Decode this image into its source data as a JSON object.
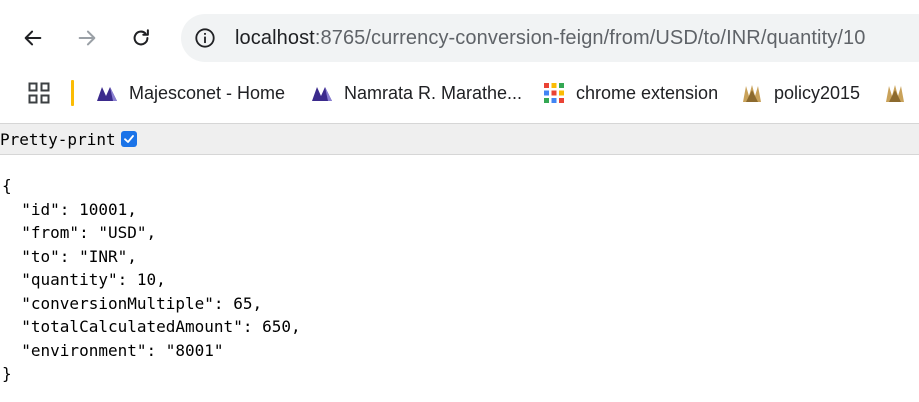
{
  "browser": {
    "url_host": "localhost",
    "url_rest": ":8765/currency-conversion-feign/from/USD/to/INR/quantity/10"
  },
  "bookmarks": [
    {
      "label": "Majesconet - Home",
      "icon": "majesco-logo-icon"
    },
    {
      "label": "Namrata R. Marathe...",
      "icon": "majesco-logo-icon"
    },
    {
      "label": "chrome extension",
      "icon": "chrome-apps-grid-icon"
    },
    {
      "label": "policy2015",
      "icon": "policy-logo-icon"
    }
  ],
  "page": {
    "pretty_print_label": "Pretty-print",
    "pretty_print_checked": true,
    "json_lines": [
      "{",
      "  \"id\": 10001,",
      "  \"from\": \"USD\",",
      "  \"to\": \"INR\",",
      "  \"quantity\": 10,",
      "  \"conversionMultiple\": 65,",
      "  \"totalCalculatedAmount\": 650,",
      "  \"environment\": \"8001\"",
      "}"
    ]
  },
  "colors": {
    "omnibox_bg": "#f1f3f4",
    "checkbox": "#1a73e8",
    "separator": "#fbbc04"
  }
}
